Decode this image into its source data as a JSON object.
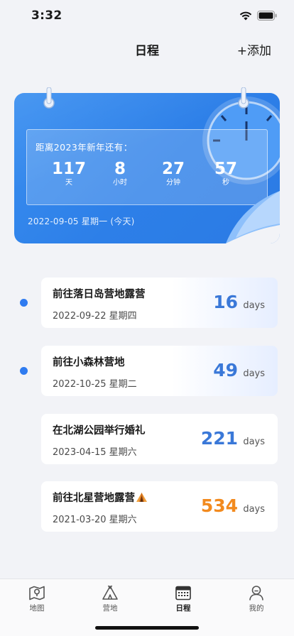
{
  "status_bar": {
    "time": "3:32"
  },
  "nav": {
    "title": "日程",
    "add_label": "+添加"
  },
  "countdown": {
    "label": "距离2023年新年还有：",
    "days": "117",
    "days_label": "天",
    "hours": "8",
    "hours_label": "小时",
    "minutes": "27",
    "minutes_label": "分钟",
    "seconds": "57",
    "seconds_label": "秒",
    "today": "2022-09-05 星期一 (今天)"
  },
  "events": [
    {
      "title": "前往落日岛营地露营",
      "date": "2022-09-22  星期四",
      "days": "16",
      "unit": "days",
      "color": "#3a78d8",
      "dot": true
    },
    {
      "title": "前往小森林营地",
      "date": "2022-10-25  星期二",
      "days": "49",
      "unit": "days",
      "color": "#3a78d8",
      "dot": true
    },
    {
      "title": "在北湖公园举行婚礼",
      "date": "2023-04-15  星期六",
      "days": "221",
      "unit": "days",
      "color": "#3a78d8",
      "dot": false
    },
    {
      "title": "前往北星营地露营",
      "date": "2021-03-20  星期六",
      "days": "534",
      "unit": "days",
      "color": "#f28a1e",
      "dot": false,
      "icon": "tent-icon"
    }
  ],
  "tabs": [
    {
      "label": "地图",
      "icon": "map-icon"
    },
    {
      "label": "营地",
      "icon": "camp-icon"
    },
    {
      "label": "日程",
      "icon": "calendar-icon",
      "active": true
    },
    {
      "label": "我的",
      "icon": "profile-icon"
    }
  ]
}
